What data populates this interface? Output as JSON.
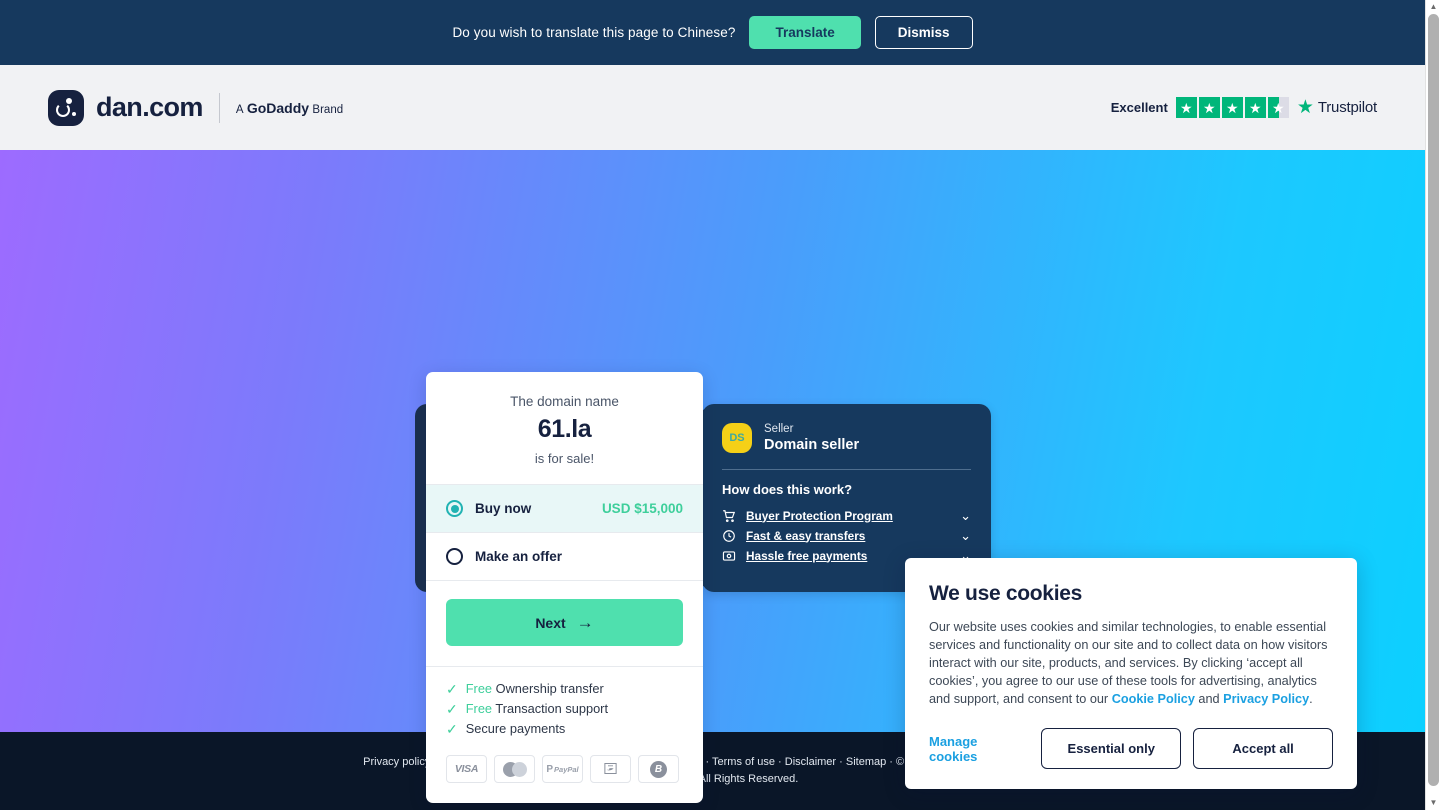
{
  "translate_bar": {
    "message": "Do you wish to translate this page to Chinese?",
    "translate_label": "Translate",
    "dismiss_label": "Dismiss",
    "bg_color": "#16395e",
    "accent_color": "#4fe0ae"
  },
  "header": {
    "brand_name": "dan.com",
    "brand_sub_prefix": "A",
    "brand_sub_name": "GoDaddy",
    "brand_sub_suffix": "Brand",
    "trustpilot": {
      "rating_word": "Excellent",
      "brand_name": "Trustpilot",
      "stars_filled": 4,
      "stars_half": 1,
      "star_color": "#00b67a"
    }
  },
  "hero": {
    "gradient_from": "#9d6bff",
    "gradient_to": "#0cd0ff"
  },
  "buy_card": {
    "pre_text": "The domain name",
    "domain_name": "61.la",
    "post_text": "is for sale!",
    "options": [
      {
        "label": "Buy now",
        "price": "USD $15,000",
        "selected": true
      },
      {
        "label": "Make an offer",
        "price": "",
        "selected": false
      }
    ],
    "next_label": "Next",
    "next_arrow": "arrow-right-icon",
    "perks": [
      {
        "free": "Free",
        "text": "Ownership transfer"
      },
      {
        "free": "Free",
        "text": "Transaction support"
      },
      {
        "free": "",
        "text": "Secure payments"
      }
    ],
    "payment_methods": [
      "visa-icon",
      "mastercard-icon",
      "paypal-icon",
      "alipay-icon",
      "bitcoin-icon"
    ],
    "payment_labels": {
      "visa": "VISA",
      "paypal_p": "P",
      "paypal_name": "PayPal",
      "bitcoin": "B"
    },
    "accent_color": "#4fe0ae",
    "price_color": "#3ecf9b"
  },
  "seller_panel": {
    "avatar_initials": "DS",
    "role_label": "Seller",
    "name": "Domain seller",
    "how_title": "How does this work?",
    "items": [
      {
        "icon": "cart-icon",
        "label": "Buyer Protection Program",
        "chevron": "chevron-down-icon"
      },
      {
        "icon": "clock-icon",
        "label": "Fast & easy transfers",
        "chevron": "chevron-down-icon"
      },
      {
        "icon": "card-icon",
        "label": "Hassle free payments",
        "chevron": "chevron-down-icon"
      }
    ],
    "bg_color": "#16395e",
    "avatar_color": "#f5d017"
  },
  "cookie_banner": {
    "title": "We use cookies",
    "body_part1": "Our website uses cookies and similar technologies, to enable essential services and functionality on our site and to collect data on how visitors interact with our site, products, and services. By clicking ‘accept all cookies’, you agree to our use of these tools for advertising, analytics and support, and consent to our ",
    "cookie_policy_link": "Cookie Policy",
    "body_part2": " and ",
    "privacy_policy_link": "Privacy Policy",
    "body_part3": ".",
    "manage_label": "Manage cookies",
    "essential_label": "Essential only",
    "accept_label": "Accept all",
    "link_color": "#1ba0e1"
  },
  "footer": {
    "text": "Privacy policy · Do not sell my personal information · Manage cookies · Terms of use · Disclaimer · Sitemap · © 2024 Dan.com an Undeveloped BV subsidiary. All Rights Reserved.",
    "bg_color": "#0a1628"
  },
  "scrollbar": {
    "up_arrow": "scroll-up-icon",
    "down_arrow": "scroll-down-icon"
  }
}
